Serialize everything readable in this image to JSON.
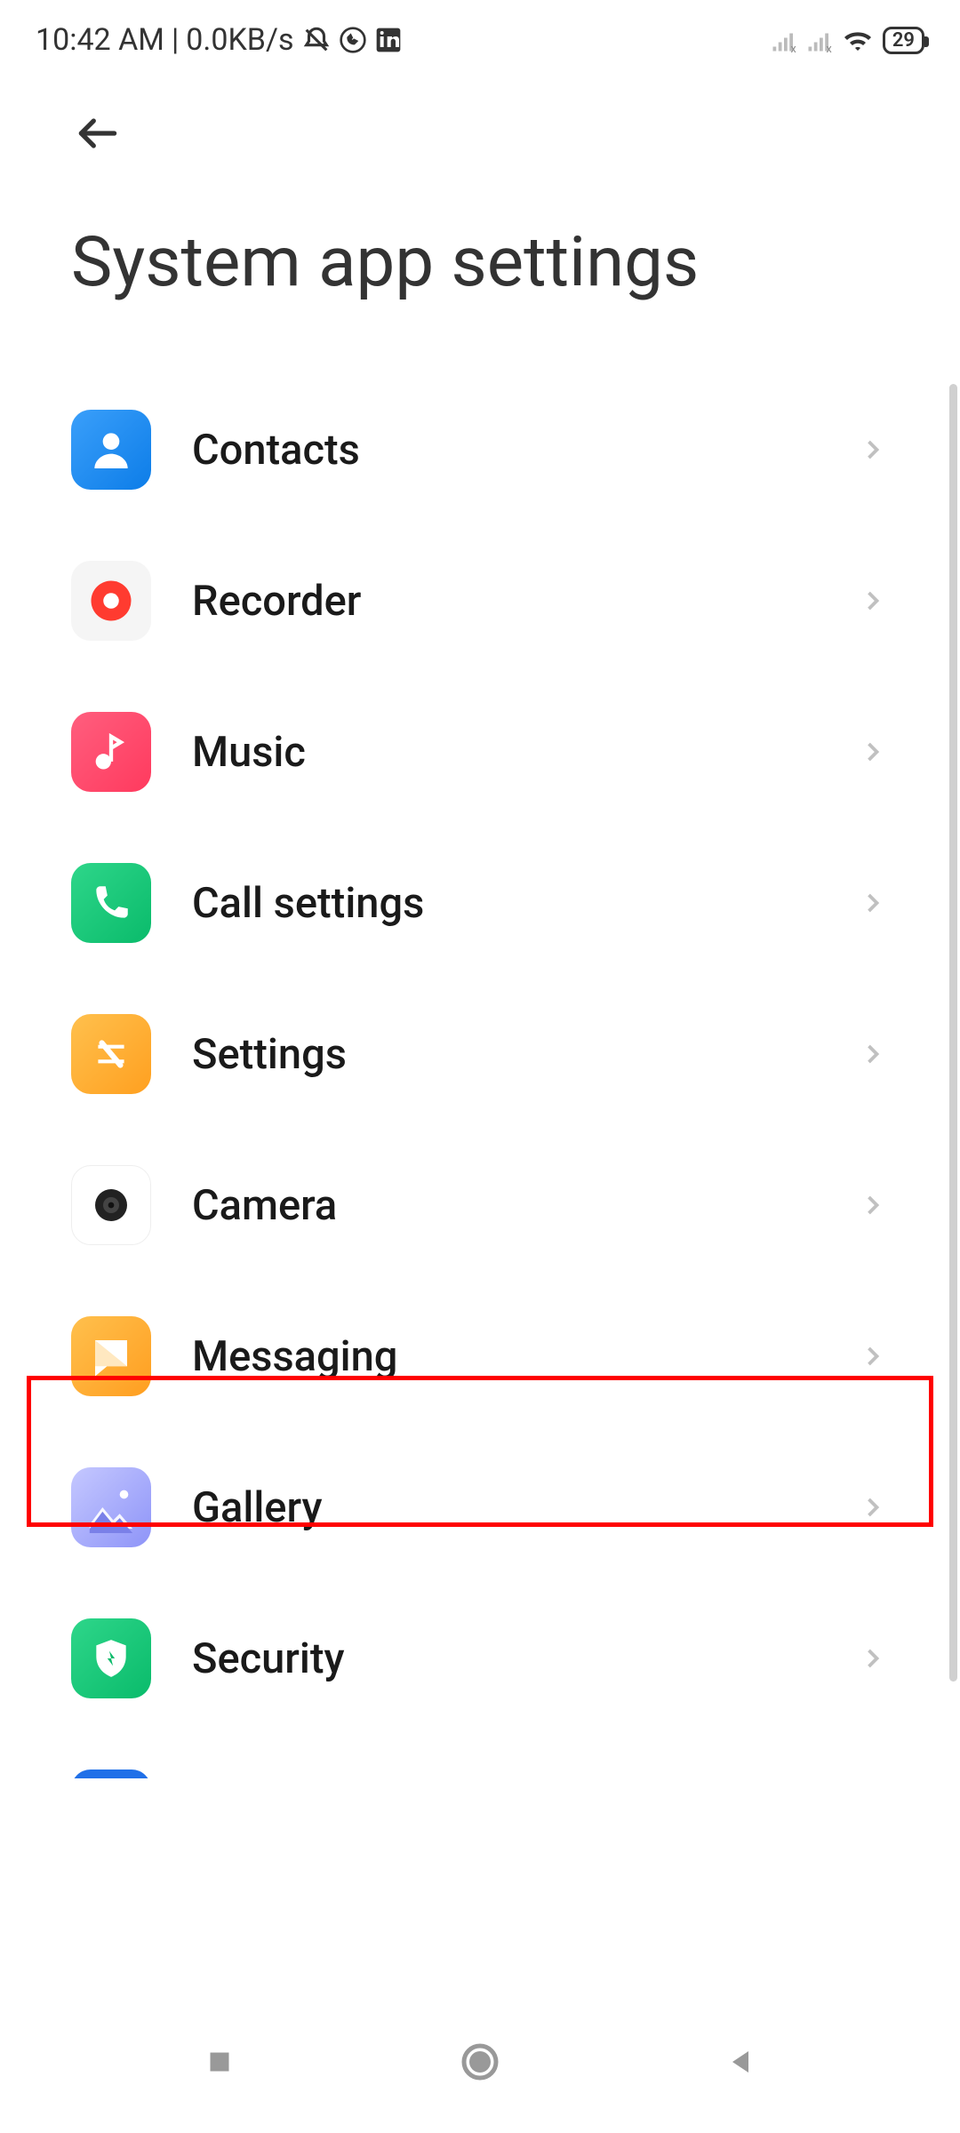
{
  "status_bar": {
    "time": "10:42 AM",
    "data_speed": "0.0KB/s",
    "battery_level": "29"
  },
  "page": {
    "title": "System app settings"
  },
  "items": [
    {
      "id": "contacts",
      "label": "Contacts",
      "icon": "contacts-icon"
    },
    {
      "id": "recorder",
      "label": "Recorder",
      "icon": "recorder-icon"
    },
    {
      "id": "music",
      "label": "Music",
      "icon": "music-icon"
    },
    {
      "id": "call-settings",
      "label": "Call settings",
      "icon": "call-icon"
    },
    {
      "id": "settings",
      "label": "Settings",
      "icon": "settings-icon"
    },
    {
      "id": "camera",
      "label": "Camera",
      "icon": "camera-icon"
    },
    {
      "id": "messaging",
      "label": "Messaging",
      "icon": "messaging-icon",
      "highlighted": true
    },
    {
      "id": "gallery",
      "label": "Gallery",
      "icon": "gallery-icon"
    },
    {
      "id": "security",
      "label": "Security",
      "icon": "security-icon"
    }
  ]
}
